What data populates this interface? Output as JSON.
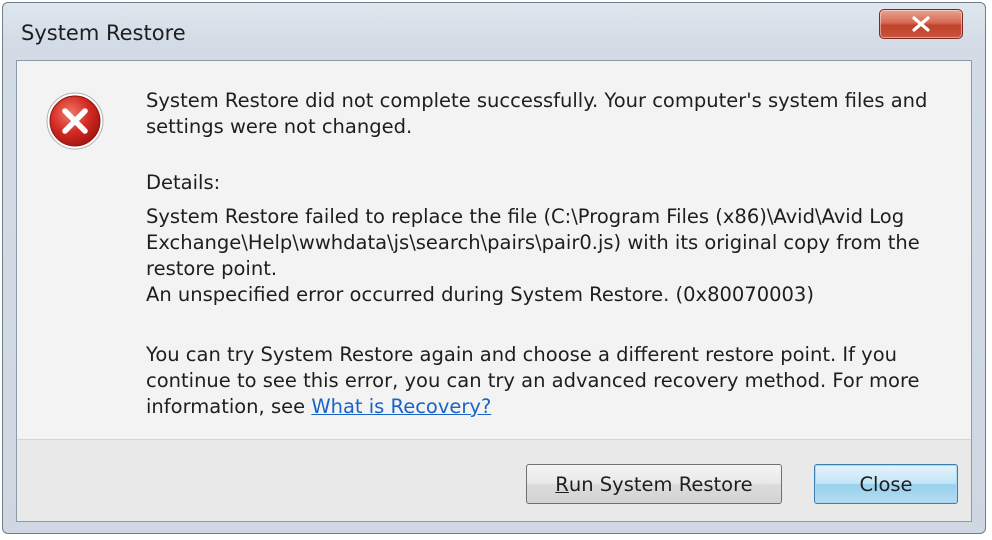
{
  "window": {
    "title": "System Restore"
  },
  "icons": {
    "error": "error-x-icon",
    "close": "close-icon"
  },
  "message": {
    "main": "System Restore did not complete successfully. Your computer's system files and settings were not changed.",
    "details_label": "Details:",
    "details_line1": "System Restore failed to replace the file (C:\\Program Files (x86)\\Avid\\Avid Log Exchange\\Help\\wwhdata\\js\\search\\pairs\\pair0.js) with its original copy from the restore point.",
    "details_line2": "An unspecified error occurred during System Restore. (0x80070003)",
    "advice": "You can try System Restore again and choose a different restore point.  If you continue to see this error, you can try an advanced recovery method. For more information, see",
    "link": "What is Recovery?"
  },
  "buttons": {
    "run_mnemonic": "R",
    "run_rest": "un System Restore",
    "close": "Close"
  },
  "colors": {
    "link": "#1a63c6",
    "error_red": "#c8201c",
    "close_button_red": "#c9553c"
  }
}
